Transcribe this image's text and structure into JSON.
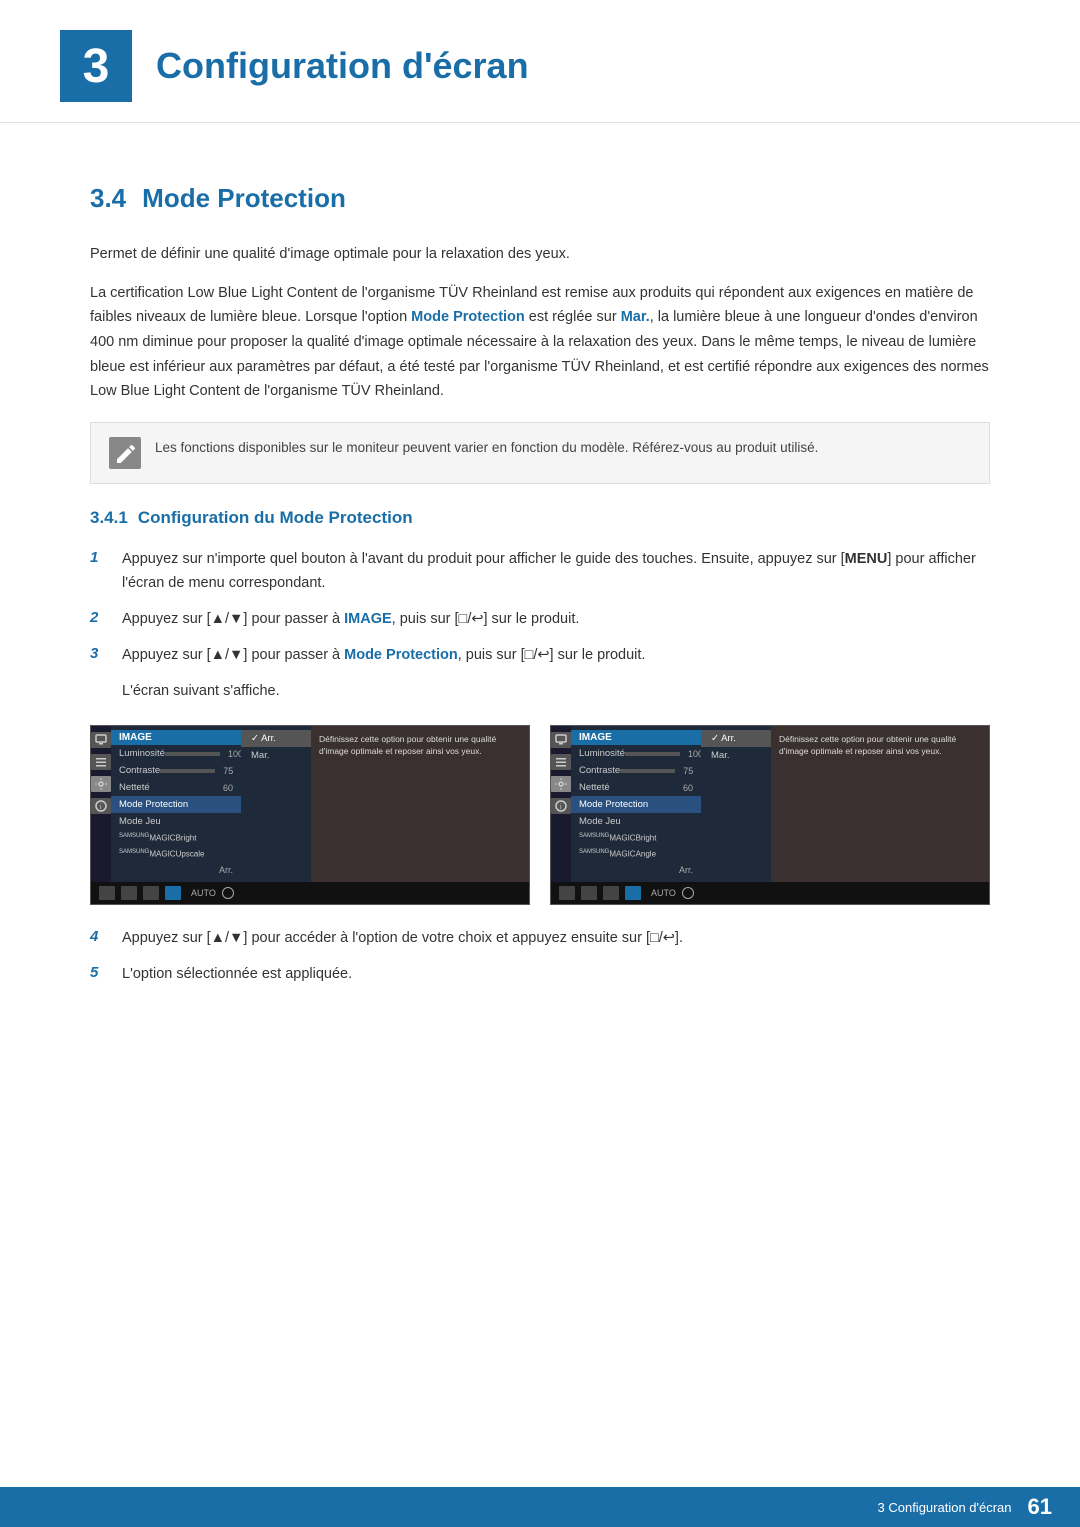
{
  "header": {
    "chapter_number": "3",
    "chapter_title": "Configuration d'écran"
  },
  "section": {
    "number": "3.4",
    "title": "Mode Protection"
  },
  "intro_paragraph_1": "Permet de définir une qualité d'image optimale pour la relaxation des yeux.",
  "intro_paragraph_2_before": "La certification Low Blue Light Content de l'organisme TÜV Rheinland est remise aux produits qui répondent aux exigences en matière de faibles niveaux de lumière bleue. Lorsque l'option ",
  "intro_highlight_1": "Mode",
  "intro_highlight_2": "Protection",
  "intro_paragraph_2_middle": " est réglée sur ",
  "intro_highlight_3": "Mar.",
  "intro_paragraph_2_after": ", la lumière bleue à une longueur d'ondes d'environ 400 nm diminue pour proposer la qualité d'image optimale nécessaire à la relaxation des yeux. Dans le même temps, le niveau de lumière bleue est inférieur aux paramètres par défaut, a été testé par l'organisme TÜV Rheinland, et est certifié répondre aux exigences des normes Low Blue Light Content de l'organisme TÜV Rheinland.",
  "note": {
    "text": "Les fonctions disponibles sur le moniteur peuvent varier en fonction du modèle. Référez-vous au produit utilisé."
  },
  "subsection": {
    "number": "3.4.1",
    "title": "Configuration du Mode Protection"
  },
  "steps": [
    {
      "number": "1",
      "text_before": "Appuyez sur n'importe quel bouton à l'avant du produit pour afficher le guide des touches. Ensuite, appuyez sur [",
      "kbd": "MENU",
      "text_after": "] pour afficher l'écran de menu correspondant."
    },
    {
      "number": "2",
      "text_before": "Appuyez sur [▲/▼] pour passer à ",
      "highlight": "IMAGE",
      "text_middle": ", puis sur [",
      "kbd": "□/↩",
      "text_after": "] sur le produit."
    },
    {
      "number": "3",
      "text_before": "Appuyez sur [▲/▼] pour passer à ",
      "highlight": "Mode Protection",
      "text_middle": ", puis sur [",
      "kbd": "□/↩",
      "text_after": "] sur le produit.",
      "sub_text": "L'écran suivant s'affiche."
    },
    {
      "number": "4",
      "text_before": "Appuyez sur [▲/▼] pour accéder à l'option de votre choix et appuyez ensuite sur [",
      "kbd": "□/↩",
      "text_after": "]."
    },
    {
      "number": "5",
      "text": "L'option sélectionnée est appliquée."
    }
  ],
  "screens": [
    {
      "menu_header": "IMAGE",
      "items": [
        {
          "label": "Luminosité",
          "value": "100",
          "has_slider": true
        },
        {
          "label": "Contraste",
          "value": "75",
          "has_slider": true
        },
        {
          "label": "Netteté",
          "value": "60",
          "has_slider": false
        },
        {
          "label": "Mode Protection",
          "active": true
        },
        {
          "label": "Mode Jeu"
        },
        {
          "label": "SAMSUNG MAGICBright"
        },
        {
          "label": "SAMSUNG MAGICUpscale"
        }
      ],
      "submenu": [
        "✓ Arr.",
        "Mar."
      ],
      "info_text": "Définissez cette option pour obtenir une qualité d'image optimale et reposer ainsi vos yeux.",
      "bottom": "AUTO"
    },
    {
      "menu_header": "IMAGE",
      "items": [
        {
          "label": "Luminosité",
          "value": "100",
          "has_slider": true
        },
        {
          "label": "Contraste",
          "value": "75",
          "has_slider": true
        },
        {
          "label": "Netteté",
          "value": "60",
          "has_slider": false
        },
        {
          "label": "Mode Protection",
          "active": true
        },
        {
          "label": "Mode Jeu"
        },
        {
          "label": "SAMSUNG MAGICBright"
        },
        {
          "label": "SAMSUNG MAGICAngle"
        }
      ],
      "submenu": [
        "✓ Arr.",
        "Mar."
      ],
      "info_text": "Définissez cette option pour obtenir une qualité d'image optimale et reposer ainsi vos yeux.",
      "bottom": "AUTO"
    }
  ],
  "footer": {
    "text": "3 Configuration d'écran",
    "page": "61"
  }
}
